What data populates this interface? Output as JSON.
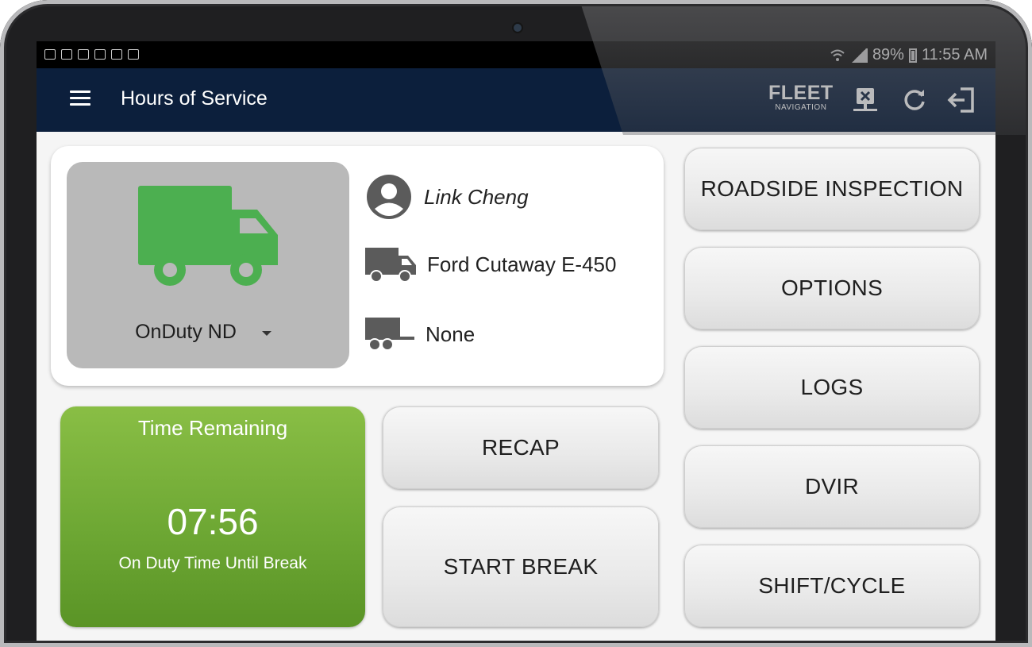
{
  "status_bar": {
    "battery": "89%",
    "time": "11:55 AM"
  },
  "app_bar": {
    "title": "Hours of Service",
    "logo_main": "FLEET",
    "logo_sub": "NAVIGATION"
  },
  "driver_card": {
    "duty_status": "OnDuty ND",
    "driver_name": "Link Cheng",
    "vehicle": "Ford Cutaway E-450",
    "trailer": "None"
  },
  "time_remaining": {
    "title": "Time Remaining",
    "time": "07:56",
    "subtitle": "On Duty Time Until Break"
  },
  "buttons": {
    "recap": "RECAP",
    "start_break": "START BREAK",
    "roadside": "ROADSIDE INSPECTION",
    "options": "OPTIONS",
    "logs": "LOGS",
    "dvir": "DVIR",
    "shift_cycle": "SHIFT/CYCLE"
  },
  "colors": {
    "app_bar": "#0c1f3c",
    "status_green": "#4caf50",
    "time_box_green": "#6ea834",
    "status_box_gray": "#b9b9b9"
  },
  "icons": [
    "menu-icon",
    "fleet-navigation-logo",
    "disconnect-icon",
    "refresh-icon",
    "logout-icon",
    "truck-icon",
    "person-icon",
    "vehicle-icon",
    "trailer-icon",
    "dropdown-caret-icon"
  ]
}
